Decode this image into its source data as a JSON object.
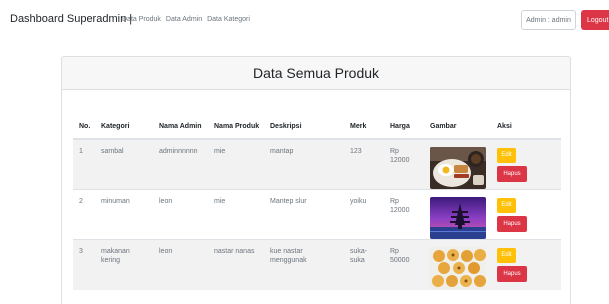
{
  "navbar": {
    "brand": "Dashboard Superadmin |",
    "links": [
      "Data Produk",
      "Data Admin",
      "Data Kategori"
    ],
    "user": "Admin : admin",
    "logout": "Logout"
  },
  "page": {
    "title": "Data Semua Produk"
  },
  "table": {
    "headers": [
      "No.",
      "Kategori",
      "Nama Admin",
      "Nama Produk",
      "Deskripsi",
      "Merk",
      "Harga",
      "Gambar",
      "Aksi"
    ],
    "rows": [
      {
        "no": "1",
        "kategori": "sambal",
        "admin": "adminnnnnn",
        "produk": "mie",
        "deskripsi": "mantap",
        "merk": "123",
        "harga": "Rp 12000",
        "gambar": "breakfast-plate-photo"
      },
      {
        "no": "2",
        "kategori": "minuman",
        "admin": "leon",
        "produk": "mie",
        "deskripsi": "Mantep slur",
        "merk": "yoiku",
        "harga": "Rp 12000",
        "gambar": "temple-sunset-photo"
      },
      {
        "no": "3",
        "kategori": "makanan kering",
        "admin": "leon",
        "produk": "nastar nanas",
        "deskripsi": "kue nastar menggunak",
        "merk": "suka-suka",
        "harga": "Rp 50000",
        "gambar": "nastar-cookies-photo"
      }
    ],
    "edit_label": "Edit",
    "delete_label": "Hapus"
  }
}
